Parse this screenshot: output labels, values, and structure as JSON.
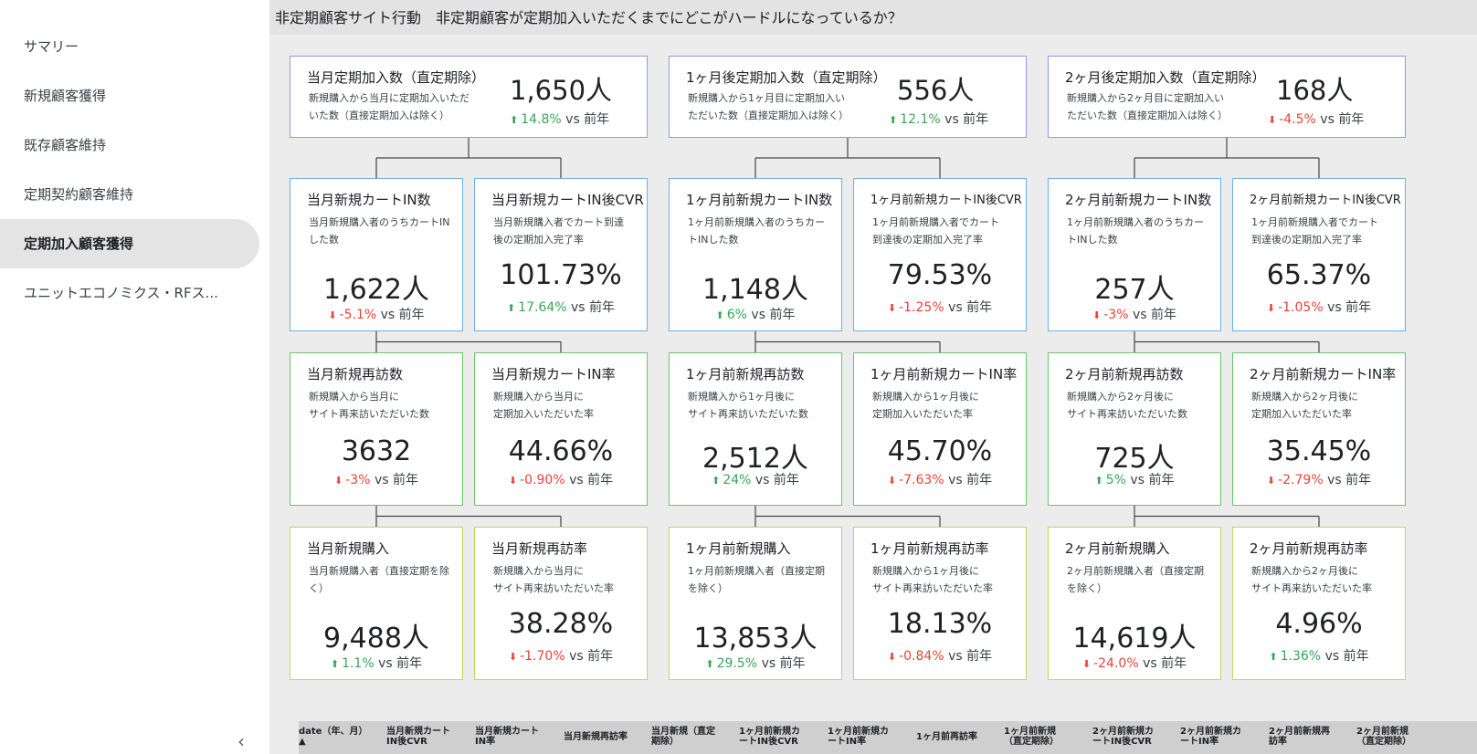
{
  "sidebar": {
    "items": [
      {
        "label": "サマリー"
      },
      {
        "label": "新規顧客獲得"
      },
      {
        "label": "既存顧客維持"
      },
      {
        "label": "定期契約顧客維持"
      },
      {
        "label": "定期加入顧客獲得"
      },
      {
        "label": "ユニットエコノミクス・RFス..."
      }
    ],
    "active_index": 4,
    "collapse_icon": "‹"
  },
  "header": {
    "title": "非定期顧客サイト行動　非定期顧客が定期加入いただくまでにどこがハードルになっているか？"
  },
  "colors": {
    "up": "#34a853",
    "down": "#ea4335"
  },
  "vs_label": "vs 前年",
  "columns": [
    {
      "top": {
        "title": "当月定期加入数（直定期除）",
        "desc": [
          "新規購入から当月に定期加入いただ",
          "いた数（直接定期加入は除く）"
        ],
        "value": "1,650人",
        "delta": "14.8%",
        "dir": "up"
      },
      "rows": [
        [
          {
            "title": "当月新規カートIN数",
            "desc": [
              "当月新規購入者のうちカートIN",
              "した数"
            ],
            "value": "1,622人",
            "delta": "-5.1%",
            "dir": "down"
          },
          {
            "title": "当月新規カートIN後CVR",
            "desc": [
              "当月新規購入者でカート到達",
              "後の定期加入完了率"
            ],
            "value": "101.73%",
            "delta": "17.64%",
            "dir": "up"
          }
        ],
        [
          {
            "title": "当月新規再訪数",
            "desc": [
              "新規購入から当月に",
              "サイト再来訪いただいた数"
            ],
            "value": "3632",
            "delta": "-3%",
            "dir": "down"
          },
          {
            "title": "当月新規カートIN率",
            "desc": [
              "新規購入から当月に",
              "定期加入いただいた率"
            ],
            "value": "44.66%",
            "delta": "-0.90%",
            "dir": "down"
          }
        ],
        [
          {
            "title": "当月新規購入",
            "desc": [
              "当月新規購入者（直接定期を除",
              "く）"
            ],
            "value": "9,488人",
            "delta": "1.1%",
            "dir": "up"
          },
          {
            "title": "当月新規再訪率",
            "desc": [
              "新規購入から当月に",
              "サイト再来訪いただいた率"
            ],
            "value": "38.28%",
            "delta": "-1.70%",
            "dir": "down"
          }
        ]
      ]
    },
    {
      "top": {
        "title": "1ヶ月後定期加入数（直定期除）",
        "desc": [
          "新規購入から1ヶ月目に定期加入い",
          "ただいた数（直接定期加入は除く）"
        ],
        "value": "556人",
        "delta": "12.1%",
        "dir": "up"
      },
      "rows": [
        [
          {
            "title": "1ヶ月前新規カートIN数",
            "desc": [
              "1ヶ月前新規購入者のうちカー",
              "トINした数"
            ],
            "value": "1,148人",
            "delta": "6%",
            "dir": "up"
          },
          {
            "title": "1ヶ月前新規カートIN後CVR",
            "desc": [
              "1ヶ月前新規購入者でカート",
              "到達後の定期加入完了率"
            ],
            "value": "79.53%",
            "delta": "-1.25%",
            "dir": "down"
          }
        ],
        [
          {
            "title": "1ヶ月前新規再訪数",
            "desc": [
              "新規購入から1ヶ月後に",
              "サイト再来訪いただいた数"
            ],
            "value": "2,512人",
            "delta": "24%",
            "dir": "up"
          },
          {
            "title": "1ヶ月前新規カートIN率",
            "desc": [
              "新規購入から1ヶ月後に",
              "定期加入いただいた率"
            ],
            "value": "45.70%",
            "delta": "-7.63%",
            "dir": "down"
          }
        ],
        [
          {
            "title": "1ヶ月前新規購入",
            "desc": [
              "1ヶ月前新規購入者（直接定期",
              "を除く）"
            ],
            "value": "13,853人",
            "delta": "29.5%",
            "dir": "up"
          },
          {
            "title": "1ヶ月前新規再訪率",
            "desc": [
              "新規購入から1ヶ月後に",
              "サイト再来訪いただいた率"
            ],
            "value": "18.13%",
            "delta": "-0.84%",
            "dir": "down"
          }
        ]
      ]
    },
    {
      "top": {
        "title": "2ヶ月後定期加入数（直定期除）",
        "desc": [
          "新規購入から2ヶ月目に定期加入い",
          "ただいた数（直接定期加入は除く）"
        ],
        "value": "168人",
        "delta": "-4.5%",
        "dir": "down"
      },
      "rows": [
        [
          {
            "title": "2ヶ月前新規カートIN数",
            "desc": [
              "1ヶ月前新規購入者のうちカー",
              "トINした数"
            ],
            "value": "257人",
            "delta": "-3%",
            "dir": "down"
          },
          {
            "title": "2ヶ月前新規カートIN後CVR",
            "desc": [
              "1ヶ月前新規購入者でカート",
              "到達後の定期加入完了率"
            ],
            "value": "65.37%",
            "delta": "-1.05%",
            "dir": "down"
          }
        ],
        [
          {
            "title": "2ヶ月前新規再訪数",
            "desc": [
              "新規購入から2ヶ月後に",
              "サイト再来訪いただいた数"
            ],
            "value": "725人",
            "delta": "5%",
            "dir": "up"
          },
          {
            "title": "2ヶ月前新規カートIN率",
            "desc": [
              "新規購入から2ヶ月後に",
              "定期加入いただいた率"
            ],
            "value": "35.45%",
            "delta": "-2.79%",
            "dir": "down"
          }
        ],
        [
          {
            "title": "2ヶ月前新規購入",
            "desc": [
              "2ヶ月前新規購入者（直接定期",
              "を除く）"
            ],
            "value": "14,619人",
            "delta": "-24.0%",
            "dir": "down"
          },
          {
            "title": "2ヶ月前新規再訪率",
            "desc": [
              "新規購入から2ヶ月後に",
              "サイト再来訪いただいた率"
            ],
            "value": "4.96%",
            "delta": "1.36%",
            "dir": "up"
          }
        ]
      ]
    }
  ],
  "table": {
    "headers": [
      {
        "lines": [
          "date（年、月）",
          "▲"
        ]
      },
      {
        "lines": [
          "当月新規カート",
          "IN後CVR"
        ]
      },
      {
        "lines": [
          "当月新規カート",
          "IN率"
        ]
      },
      {
        "lines": [
          "当月新規再訪率"
        ]
      },
      {
        "lines": [
          "当月新規（直定",
          "期除）"
        ]
      },
      {
        "lines": [
          "1ヶ月前新規カ",
          "ートIN後CVR"
        ]
      },
      {
        "lines": [
          "1ヶ月前新規カ",
          "ートIN率"
        ]
      },
      {
        "lines": [
          "1ヶ月前再訪率"
        ]
      },
      {
        "lines": [
          "1ヶ月前新規",
          "（直定期除）"
        ]
      },
      {
        "lines": [
          "2ヶ月前新規カ",
          "ートIN後CVR"
        ]
      },
      {
        "lines": [
          "2ヶ月前新規カ",
          "ートIN率"
        ]
      },
      {
        "lines": [
          "2ヶ月前新規再",
          "訪率"
        ]
      },
      {
        "lines": [
          "2ヶ月前新規",
          "（直定期除）"
        ]
      }
    ]
  }
}
